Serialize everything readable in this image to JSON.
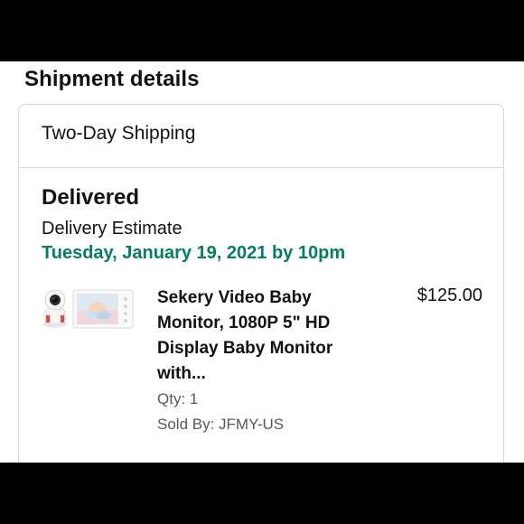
{
  "section_title": "Shipment details",
  "shipment": {
    "shipping_speed": "Two-Day Shipping",
    "status": "Delivered",
    "estimate_label": "Delivery Estimate",
    "estimate_date": "Tuesday, January 19, 2021 by 10pm",
    "estimate_color": "#067d62"
  },
  "item": {
    "title": "Sekery Video Baby Monitor, 1080P 5\" HD Display Baby Monitor with...",
    "price": "$125.00",
    "qty": "Qty: 1",
    "sold_by": "Sold By: JFMY-US",
    "image_icon": "baby-monitor-product-image"
  }
}
